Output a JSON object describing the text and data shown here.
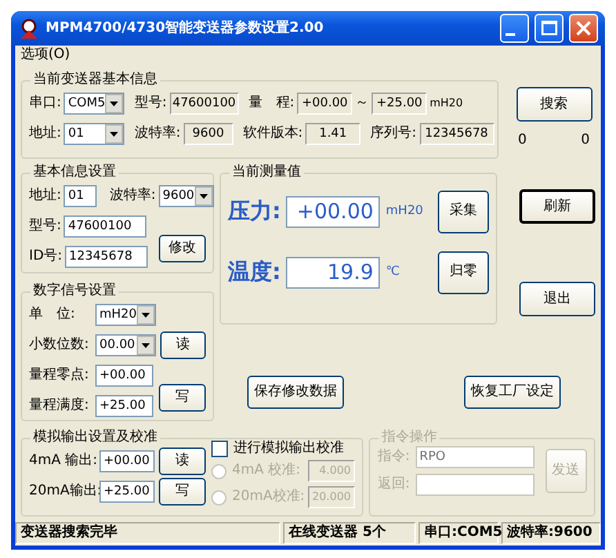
{
  "window": {
    "title": "MPM4700/4730智能变送器参数设置2.00"
  },
  "menu": [
    {
      "label": "选项(O)"
    }
  ],
  "device_info": {
    "title": "当前变送器基本信息",
    "lines": [
      {
        "fields": [
          {
            "label": "串口:",
            "kind": "select",
            "value": "COM5"
          },
          {
            "label": "型号:",
            "kind": "readonly",
            "value": "47600100"
          },
          {
            "label": "量　程:",
            "kind": "readonly",
            "value": "+00.00",
            "separator": "～",
            "value_to": "+25.00",
            "unit": "mH20"
          }
        ]
      },
      {
        "fields": [
          {
            "label": "地址:",
            "kind": "select",
            "value": "01"
          },
          {
            "label": "波特率:",
            "kind": "readonly",
            "value": "9600"
          },
          {
            "label": "软件版本:",
            "kind": "readonly",
            "value": "1.41"
          },
          {
            "label": "序列号:",
            "kind": "readonly",
            "value": "12345678"
          }
        ]
      }
    ]
  },
  "side": {
    "search_button": {
      "label": "搜索",
      "focused": false
    },
    "counters": [
      "0",
      "0"
    ],
    "refresh_button": {
      "label": "刷新",
      "focused": true
    },
    "exit_button": {
      "label": "退出",
      "focused": false
    }
  },
  "basic_settings": {
    "title": "基本信息设置",
    "lines": [
      {
        "fields": [
          {
            "label": "地址:",
            "kind": "input",
            "value": "01"
          },
          {
            "label": "波特率:",
            "kind": "select",
            "value": "9600"
          }
        ]
      },
      {
        "fields": [
          {
            "label": "型号:",
            "kind": "input",
            "value": "47600100"
          }
        ]
      },
      {
        "fields": [
          {
            "label": "ID号:",
            "kind": "input",
            "value": "12345678"
          }
        ],
        "button": "修改"
      }
    ]
  },
  "measurement": {
    "title": "当前测量值",
    "lines": [
      {
        "label": "压力:",
        "value": "+00.00",
        "unit": "mH20",
        "button": "采集"
      },
      {
        "label": "温度:",
        "value": "19.9",
        "unit": "℃",
        "button": "归零"
      }
    ]
  },
  "digital_settings": {
    "title": "数字信号设置",
    "lines": [
      {
        "fields": [
          {
            "label": "单　位:",
            "kind": "select",
            "value": "mH20"
          }
        ]
      },
      {
        "fields": [
          {
            "label": "小数位数:",
            "kind": "select",
            "value": "00.00"
          }
        ],
        "button": "读"
      },
      {
        "fields": [
          {
            "label": "量程零点:",
            "kind": "input",
            "value": "+00.00"
          }
        ]
      },
      {
        "fields": [
          {
            "label": "量程满度:",
            "kind": "input",
            "value": "+25.00"
          }
        ],
        "button": "写"
      }
    ]
  },
  "actions": [
    "保存修改数据",
    "恢复工厂设定"
  ],
  "analog_output": {
    "title": "模拟输出设置及校准",
    "lines": [
      {
        "fields": [
          {
            "label": "4mA 输出:",
            "kind": "input",
            "value": "+00.00"
          }
        ],
        "button": "读"
      },
      {
        "fields": [
          {
            "label": "20mA输出:",
            "kind": "input",
            "value": "+25.00"
          }
        ],
        "button": "写"
      }
    ],
    "calibration": {
      "label": "进行模拟输出校准",
      "checked": false,
      "options": [
        {
          "label": "4mA 校准:",
          "value": "4.000",
          "selected": false,
          "disabled": true
        },
        {
          "label": "20mA校准:",
          "value": "20.000",
          "selected": false,
          "disabled": true
        }
      ]
    }
  },
  "command": {
    "title": "指令操作",
    "disabled": true,
    "fields": [
      {
        "label": "指令:",
        "value": "RPO"
      },
      {
        "label": "返回:"
      }
    ],
    "button": "发送"
  },
  "status_bar": [
    "变送器搜索完毕",
    "在线变送器 5个",
    "串口:COM5",
    "波特率:9600"
  ]
}
